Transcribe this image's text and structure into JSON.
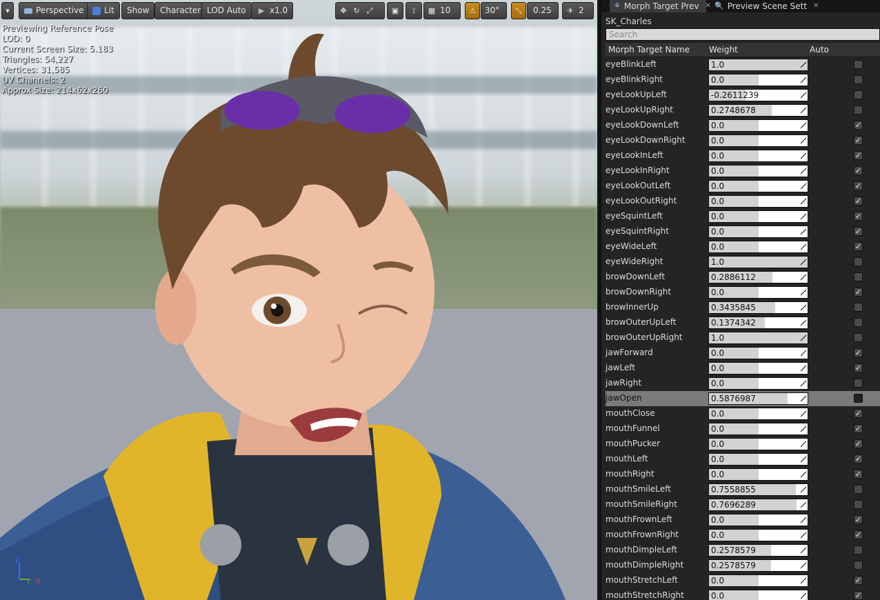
{
  "toolbar": {
    "menu_arrow": "▾",
    "perspective": "Perspective",
    "lit": "Lit",
    "show": "Show",
    "character": "Character",
    "lod": "LOD Auto",
    "speed": "x1.0",
    "grid_size": "10",
    "rot_snap": "30°",
    "scale_snap": "0.25",
    "camera_speed": "2"
  },
  "stats": {
    "line1": "Previewing Reference Pose",
    "line2": "LOD: 0",
    "line3": "Current Screen Size: 5.183",
    "line4": "Triangles: 54,227",
    "line5": "Vertices: 31,585",
    "line6": "UV Channels: 2",
    "line7": "Approx Size: 214x62x260"
  },
  "axis": {
    "z": "Z",
    "y": "Y",
    "x": "X"
  },
  "panel": {
    "tab1": "Morph Target Prev",
    "tab2": "Preview Scene Sett",
    "close": "✕",
    "asset": "SK_Charles",
    "search_placeholder": "Search",
    "col_name": "Morph Target Name",
    "col_weight": "Weight",
    "col_auto": "Auto"
  },
  "morphs": [
    {
      "name": "eyeBlinkLeft",
      "weight": "1.0",
      "w": 1.0,
      "auto": false
    },
    {
      "name": "eyeBlinkRight",
      "weight": "0.0",
      "w": 0.0,
      "auto": false
    },
    {
      "name": "eyeLookUpLeft",
      "weight": "-0.2611239",
      "w": 0.37,
      "auto": false
    },
    {
      "name": "eyeLookUpRight",
      "weight": "0.2748678",
      "w": 0.637,
      "auto": false
    },
    {
      "name": "eyeLookDownLeft",
      "weight": "0.0",
      "w": 0.0,
      "auto": true
    },
    {
      "name": "eyeLookDownRight",
      "weight": "0.0",
      "w": 0.0,
      "auto": true
    },
    {
      "name": "eyeLookInLeft",
      "weight": "0.0",
      "w": 0.0,
      "auto": true
    },
    {
      "name": "eyeLookInRight",
      "weight": "0.0",
      "w": 0.0,
      "auto": true
    },
    {
      "name": "eyeLookOutLeft",
      "weight": "0.0",
      "w": 0.0,
      "auto": true
    },
    {
      "name": "eyeLookOutRight",
      "weight": "0.0",
      "w": 0.0,
      "auto": true
    },
    {
      "name": "eyeSquintLeft",
      "weight": "0.0",
      "w": 0.0,
      "auto": true
    },
    {
      "name": "eyeSquintRight",
      "weight": "0.0",
      "w": 0.0,
      "auto": true
    },
    {
      "name": "eyeWideLeft",
      "weight": "0.0",
      "w": 0.0,
      "auto": true
    },
    {
      "name": "eyeWideRight",
      "weight": "1.0",
      "w": 1.0,
      "auto": false
    },
    {
      "name": "browDownLeft",
      "weight": "0.2886112",
      "w": 0.644,
      "auto": false
    },
    {
      "name": "browDownRight",
      "weight": "0.0",
      "w": 0.0,
      "auto": true
    },
    {
      "name": "browInnerUp",
      "weight": "0.3435845",
      "w": 0.672,
      "auto": false
    },
    {
      "name": "browOuterUpLeft",
      "weight": "0.1374342",
      "w": 0.569,
      "auto": false
    },
    {
      "name": "browOuterUpRight",
      "weight": "1.0",
      "w": 1.0,
      "auto": false
    },
    {
      "name": "jawForward",
      "weight": "0.0",
      "w": 0.0,
      "auto": true
    },
    {
      "name": "jawLeft",
      "weight": "0.0",
      "w": 0.0,
      "auto": true
    },
    {
      "name": "jawRight",
      "weight": "0.0",
      "w": 0.0,
      "auto": false
    },
    {
      "name": "jawOpen",
      "weight": "0.5876987",
      "w": 0.794,
      "auto": false,
      "selected": true
    },
    {
      "name": "mouthClose",
      "weight": "0.0",
      "w": 0.0,
      "auto": true
    },
    {
      "name": "mouthFunnel",
      "weight": "0.0",
      "w": 0.0,
      "auto": true
    },
    {
      "name": "mouthPucker",
      "weight": "0.0",
      "w": 0.0,
      "auto": true
    },
    {
      "name": "mouthLeft",
      "weight": "0.0",
      "w": 0.0,
      "auto": true
    },
    {
      "name": "mouthRight",
      "weight": "0.0",
      "w": 0.0,
      "auto": true
    },
    {
      "name": "mouthSmileLeft",
      "weight": "0.7558855",
      "w": 0.878,
      "auto": false
    },
    {
      "name": "mouthSmileRight",
      "weight": "0.7696289",
      "w": 0.885,
      "auto": false
    },
    {
      "name": "mouthFrownLeft",
      "weight": "0.0",
      "w": 0.0,
      "auto": true
    },
    {
      "name": "mouthFrownRight",
      "weight": "0.0",
      "w": 0.0,
      "auto": true
    },
    {
      "name": "mouthDimpleLeft",
      "weight": "0.2578579",
      "w": 0.629,
      "auto": false
    },
    {
      "name": "mouthDimpleRight",
      "weight": "0.2578579",
      "w": 0.629,
      "auto": false
    },
    {
      "name": "mouthStretchLeft",
      "weight": "0.0",
      "w": 0.0,
      "auto": true
    },
    {
      "name": "mouthStretchRight",
      "weight": "0.0",
      "w": 0.0,
      "auto": true
    }
  ]
}
